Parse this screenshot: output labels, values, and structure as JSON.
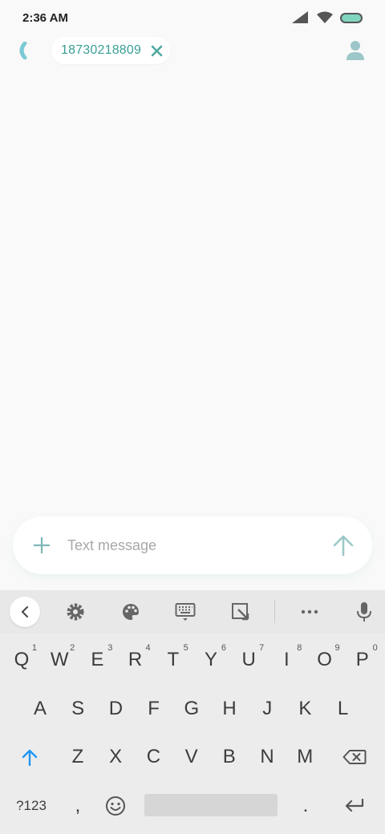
{
  "status_bar": {
    "time": "2:36 AM",
    "icons": [
      "signal-icon",
      "wifi-icon",
      "battery-icon"
    ]
  },
  "top_bar": {
    "back_icon": "chevron-left-icon",
    "recipient": "18730218809",
    "remove_icon": "close-icon",
    "contact_icon": "person-icon"
  },
  "composer": {
    "placeholder": "Text message",
    "value": "",
    "attach_icon": "plus-icon",
    "send_icon": "arrow-up-icon"
  },
  "keyboard": {
    "toolbar": [
      "chevron-left-icon",
      "gear-icon",
      "palette-icon",
      "keyboard-icon",
      "resize-icon",
      "more-icon",
      "mic-icon"
    ],
    "row1": [
      {
        "label": "Q",
        "hint": "1"
      },
      {
        "label": "W",
        "hint": "2"
      },
      {
        "label": "E",
        "hint": "3"
      },
      {
        "label": "R",
        "hint": "4"
      },
      {
        "label": "T",
        "hint": "5"
      },
      {
        "label": "Y",
        "hint": "6"
      },
      {
        "label": "U",
        "hint": "7"
      },
      {
        "label": "I",
        "hint": "8"
      },
      {
        "label": "O",
        "hint": "9"
      },
      {
        "label": "P",
        "hint": "0"
      }
    ],
    "row2": [
      "A",
      "S",
      "D",
      "F",
      "G",
      "H",
      "J",
      "K",
      "L"
    ],
    "row3": [
      "Z",
      "X",
      "C",
      "V",
      "B",
      "N",
      "M"
    ],
    "symbols_label": "?123",
    "comma_label": ",",
    "period_label": ".",
    "accent_color": "#2196f3"
  },
  "colors": {
    "accent": "#3a9e95",
    "battery": "#80d5c0"
  }
}
